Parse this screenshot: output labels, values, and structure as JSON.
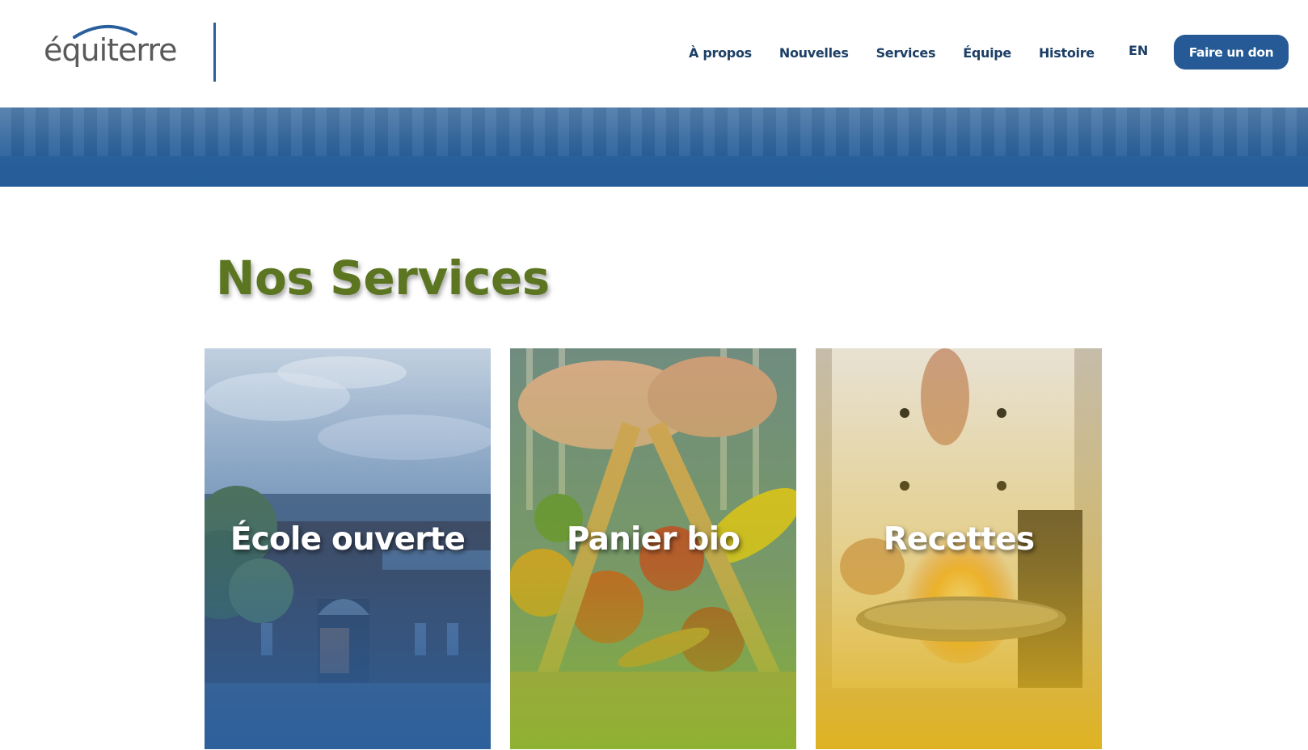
{
  "header": {
    "logo_text": "équiterre",
    "nav": [
      {
        "label": "À propos"
      },
      {
        "label": "Nouvelles"
      },
      {
        "label": "Services"
      },
      {
        "label": "Équipe"
      },
      {
        "label": "Histoire"
      }
    ],
    "language_label": "EN",
    "donate_label": "Faire un don"
  },
  "main": {
    "section_title": "Nos Services",
    "cards": [
      {
        "label": "École ouverte",
        "overlay_color": "#2a5f9e"
      },
      {
        "label": "Panier bio",
        "overlay_color": "#8ab52e"
      },
      {
        "label": "Recettes",
        "overlay_color": "#e0b21b"
      }
    ]
  },
  "colors": {
    "brand_blue": "#255a96",
    "nav_text": "#1d3f66",
    "title_green": "#5b7520"
  }
}
